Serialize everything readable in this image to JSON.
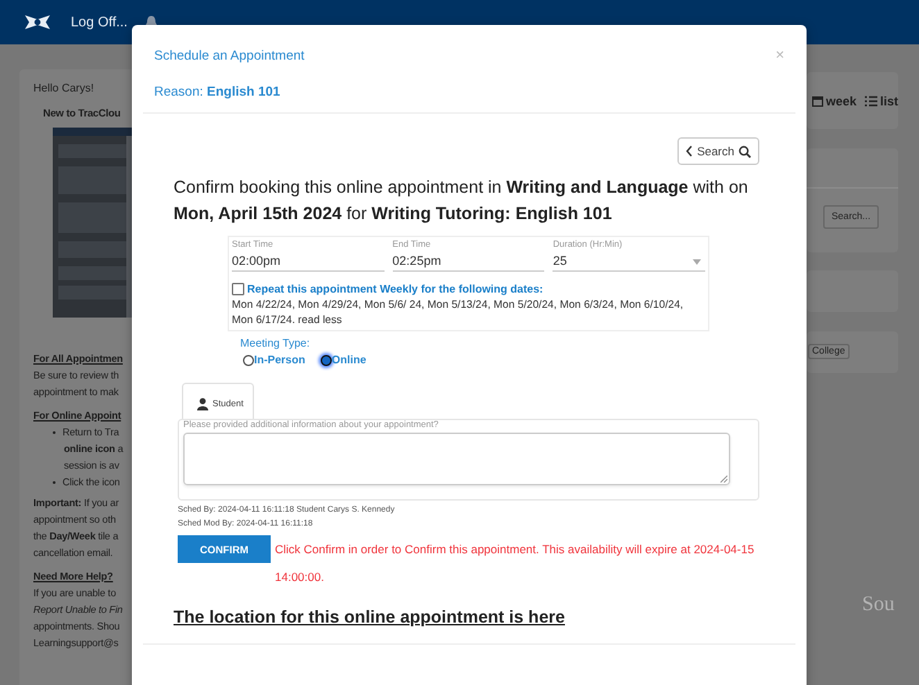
{
  "navbar": {
    "logoff": "Log Off..."
  },
  "left_panel": {
    "greeting": "Hello Carys!",
    "intro_title": "New to TracClou",
    "lines": [
      {
        "kind": "heading",
        "text": "For All Appointmen"
      },
      {
        "kind": "text",
        "text": "Be sure to review th"
      },
      {
        "kind": "text",
        "text": "appointment to mak"
      },
      {
        "kind": "heading",
        "text": "For Online Appoint"
      },
      {
        "kind": "bullet",
        "text": "Return to Tra"
      },
      {
        "kind": "indent",
        "text": "**online icon** a"
      },
      {
        "kind": "indent",
        "text": "session is av"
      },
      {
        "kind": "bullet",
        "text": "Click the icon"
      },
      {
        "kind": "lead",
        "text": "**Important:** If you ar"
      },
      {
        "kind": "text",
        "text": "appointment so oth"
      },
      {
        "kind": "text",
        "text": "the **Day/Week** tile a"
      },
      {
        "kind": "text",
        "text": "cancellation email."
      },
      {
        "kind": "heading",
        "text": "Need More Help?"
      },
      {
        "kind": "text",
        "text": "If you are unable to"
      },
      {
        "kind": "text",
        "text": "*Report Unable to Fin*"
      },
      {
        "kind": "text",
        "text": "appointments. Shou"
      },
      {
        "kind": "text",
        "text": "Learningsupport@s"
      }
    ]
  },
  "right_panel": {
    "view_buttons": [
      {
        "kind": "calendar",
        "label": "week"
      },
      {
        "kind": "list",
        "label": "list"
      }
    ],
    "search_button": "Search...",
    "college_button": "College",
    "footer_text": "Sou"
  },
  "modal": {
    "title": "Schedule an Appointment",
    "close": "×",
    "reason": "Reason: **English 101**",
    "search_button": "Search",
    "message": "Confirm booking this online appointment in **Writing and Language** with on **Mon, April 15th 2024** for **Writing Tutoring: English 101**",
    "fields": [
      {
        "kind": "text",
        "label": "Start Time",
        "value": "02:00pm"
      },
      {
        "kind": "text",
        "label": "End Time",
        "value": "02:25pm"
      },
      {
        "kind": "select",
        "label": "Duration (Hr:Min)",
        "value": "25"
      }
    ],
    "repeat": {
      "checked": false,
      "label": "Repeat this appointment Weekly for the following dates:",
      "dates": "Mon 4/22/24, Mon 4/29/24, Mon 5/6/ 24, Mon 5/13/24, Mon 5/20/24, Mon 6/3/24, Mon 6/10/24, Mon 6/17/24. read less"
    },
    "meeting_type": {
      "label": "Meeting Type:",
      "options": [
        {
          "label": "In-Person",
          "selected": false
        },
        {
          "label": "Online",
          "selected": true
        }
      ]
    },
    "tabs": [
      {
        "label": "Student",
        "selected": true
      }
    ],
    "notes_label": "Please provided additional information about your appointment?",
    "sched_by": "Sched By: 2024-04-11 16:11:18 Student Carys S. Kennedy",
    "sched_mod_by": "Sched Mod By: 2024-04-11 16:11:18",
    "confirm_button": "CONFIRM",
    "notice": "Click Confirm in order to Confirm this appointment. This availability will expire at 2024-04-15 14:00:00.",
    "location_link": "The location for this online appointment is here"
  }
}
